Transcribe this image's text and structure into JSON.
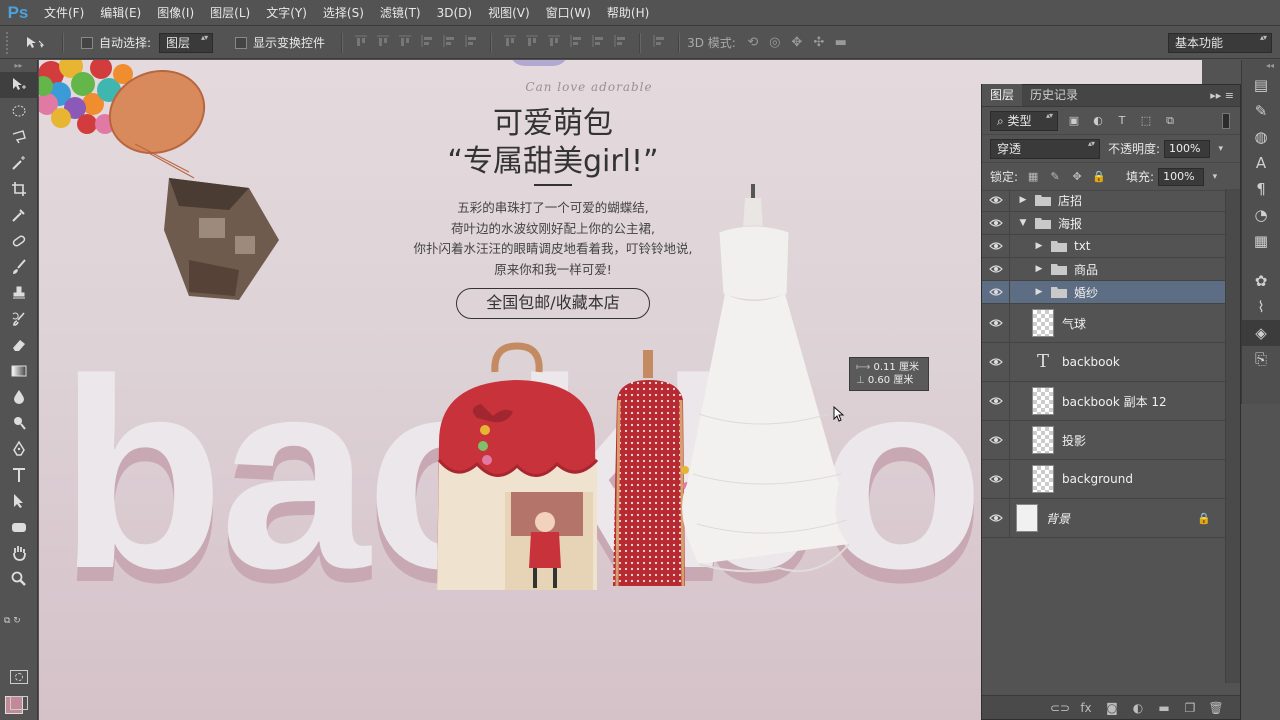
{
  "app": {
    "logo": "Ps"
  },
  "menu": [
    "文件(F)",
    "编辑(E)",
    "图像(I)",
    "图层(L)",
    "文字(Y)",
    "选择(S)",
    "滤镜(T)",
    "3D(D)",
    "视图(V)",
    "窗口(W)",
    "帮助(H)"
  ],
  "options": {
    "auto_select_label": "自动选择:",
    "auto_select_value": "图层",
    "transform_label": "显示变换控件",
    "mode_3d_label": "3D 模式:",
    "workspace": "基本功能"
  },
  "colors": {
    "foreground": "#c08a98",
    "background": "#ffffff",
    "selection": "#5d6d83"
  },
  "poster": {
    "script": "Can love adorable",
    "title_1": "可爱萌包",
    "title_2": "“专属甜美girl!”",
    "desc_lines": [
      "五彩的串珠打了一个可爱的蝴蝶结,",
      "荷叶边的水波纹刚好配上你的公主裙,",
      "你扑闪着水汪汪的眼睛调皮地看着我，叮铃铃地说,",
      "原来你和我一样可爱!"
    ],
    "cta": "全国包邮/收藏本店",
    "bigtext": "backbook"
  },
  "measure": {
    "line1": "0.11 厘米",
    "line2": "0.60 厘米"
  },
  "layers_panel": {
    "tabs": [
      "图层",
      "历史记录"
    ],
    "filter_label": "类型",
    "blend_mode": "穿透",
    "opacity_label": "不透明度:",
    "opacity_value": "100%",
    "lock_label": "锁定:",
    "fill_label": "填充:",
    "fill_value": "100%",
    "layers": [
      {
        "name": "店招",
        "kind": "group",
        "indent": 0,
        "expanded": false,
        "selected": false
      },
      {
        "name": "海报",
        "kind": "group",
        "indent": 0,
        "expanded": true,
        "selected": false
      },
      {
        "name": "txt",
        "kind": "group",
        "indent": 1,
        "expanded": false,
        "selected": false
      },
      {
        "name": "商品",
        "kind": "group",
        "indent": 1,
        "expanded": false,
        "selected": false
      },
      {
        "name": "婚纱",
        "kind": "group",
        "indent": 1,
        "expanded": false,
        "selected": true
      },
      {
        "name": "气球",
        "kind": "pixel",
        "indent": 1,
        "selected": false
      },
      {
        "name": "backbook",
        "kind": "text",
        "indent": 1,
        "selected": false
      },
      {
        "name": "backbook 副本 12",
        "kind": "pixel",
        "indent": 1,
        "selected": false
      },
      {
        "name": "投影",
        "kind": "pixel",
        "indent": 1,
        "selected": false
      },
      {
        "name": "background",
        "kind": "pixel",
        "indent": 1,
        "selected": false
      },
      {
        "name": "背景",
        "kind": "background",
        "indent": 0,
        "selected": false,
        "locked": true
      }
    ]
  }
}
